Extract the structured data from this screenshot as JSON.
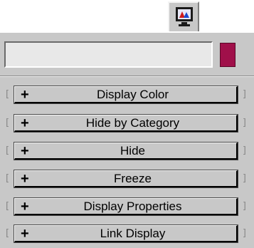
{
  "tab": {
    "icon": "display-monitor-icon"
  },
  "name_field": {
    "value": ""
  },
  "color_swatch": {
    "color": "#a0104a"
  },
  "rollouts": [
    {
      "expand_symbol": "+",
      "label": "Display Color"
    },
    {
      "expand_symbol": "+",
      "label": "Hide by Category"
    },
    {
      "expand_symbol": "+",
      "label": "Hide"
    },
    {
      "expand_symbol": "+",
      "label": "Freeze"
    },
    {
      "expand_symbol": "+",
      "label": "Display Properties"
    },
    {
      "expand_symbol": "+",
      "label": "Link Display"
    }
  ]
}
